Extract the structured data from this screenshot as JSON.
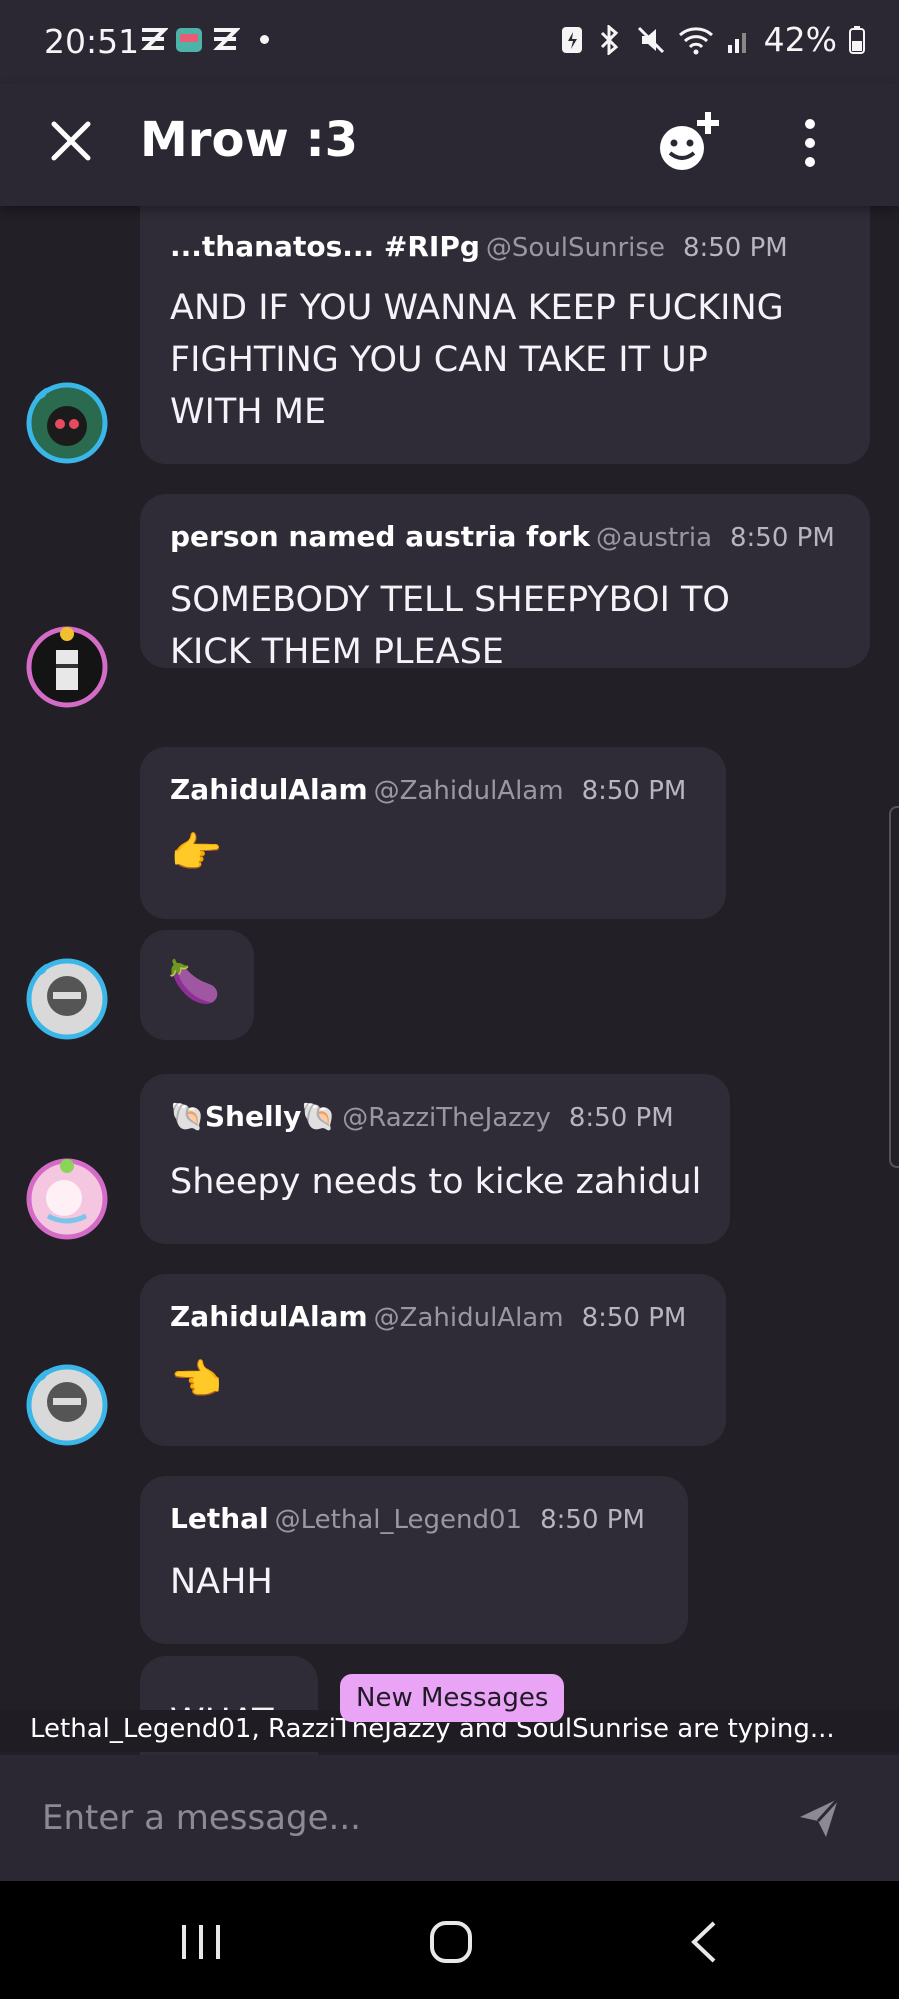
{
  "status_bar": {
    "time": "20:51",
    "battery_pct": "42%"
  },
  "header": {
    "title": "Mrow :3"
  },
  "messages": [
    {
      "name": "...thanatos...  #RIPg",
      "handle": "@SoulSunrise",
      "time": "8:50 PM",
      "lines": [
        "AND IF YOU WANNA KEEP FUCKING",
        "FIGHTING YOU CAN TAKE IT UP",
        "WITH ME"
      ]
    },
    {
      "name": "person named austria fork",
      "handle": "@austria",
      "time": "8:50 PM",
      "lines": [
        "SOMEBODY TELL SHEEPYBOI TO",
        "KICK THEM PLEASE"
      ]
    },
    {
      "name": "ZahidulAlam",
      "handle": "@ZahidulAlam",
      "time": "8:50 PM",
      "lines": [
        "👉"
      ]
    },
    {
      "lines": [
        "🍆"
      ]
    },
    {
      "name": "🐚Shelly🐚",
      "handle": "@RazziTheJazzy",
      "time": "8:50 PM",
      "lines": [
        "Sheepy needs to kicke zahidul"
      ]
    },
    {
      "name": "ZahidulAlam",
      "handle": "@ZahidulAlam",
      "time": "8:50 PM",
      "lines": [
        "👈"
      ]
    },
    {
      "name": "Lethal",
      "handle": "@Lethal_Legend01",
      "time": "8:50 PM",
      "lines": [
        "NAHH"
      ]
    },
    {
      "lines": [
        "WHAT"
      ]
    }
  ],
  "new_messages_label": "New Messages",
  "typing_indicator": "Lethal_Legend01, RazziTheJazzy and SoulSunrise are typing...",
  "composer": {
    "placeholder": "Enter a message..."
  },
  "colors": {
    "background": "#221f27",
    "bubble": "#2f2c37",
    "header": "#2b2834",
    "new_messages_pill": "#e9a4f6",
    "avatar_ring_blue": "#3bb6e8",
    "avatar_ring_pink": "#d46cc7"
  },
  "icons": [
    "close-icon",
    "add-emoji-icon",
    "more-vert-icon",
    "send-icon",
    "recents-icon",
    "home-icon",
    "back-icon"
  ]
}
